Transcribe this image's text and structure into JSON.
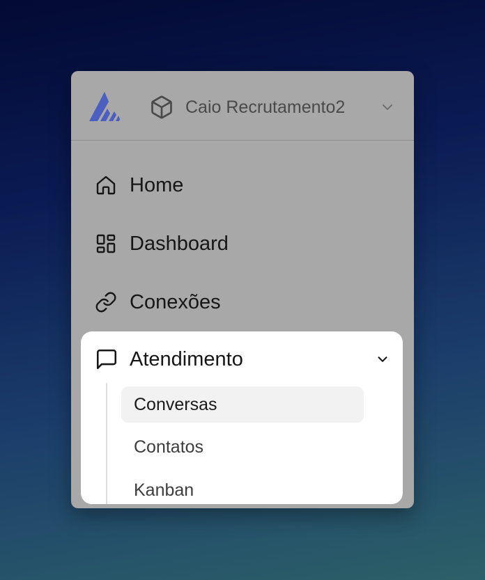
{
  "header": {
    "logo_icon": "brand-logo-icon",
    "org_icon": "cube-icon",
    "org_name": "Caio Recrutamento2",
    "switch_icon": "chevron-down-icon"
  },
  "nav": {
    "items": [
      {
        "label": "Home",
        "icon": "home-icon"
      },
      {
        "label": "Dashboard",
        "icon": "dashboard-grid-icon"
      },
      {
        "label": "Conexões",
        "icon": "link-icon"
      }
    ],
    "expanded_group": {
      "label": "Atendimento",
      "icon": "message-square-icon",
      "toggle_icon": "chevron-down-icon",
      "children": [
        {
          "label": "Conversas",
          "active": true
        },
        {
          "label": "Contatos",
          "active": false
        },
        {
          "label": "Kanban",
          "active": false
        }
      ]
    }
  },
  "colors": {
    "brand": "#4a5fbf",
    "panel_bg": "#a8a8a8",
    "expanded_bg": "#ffffff",
    "active_item_bg": "#f2f2f2"
  }
}
